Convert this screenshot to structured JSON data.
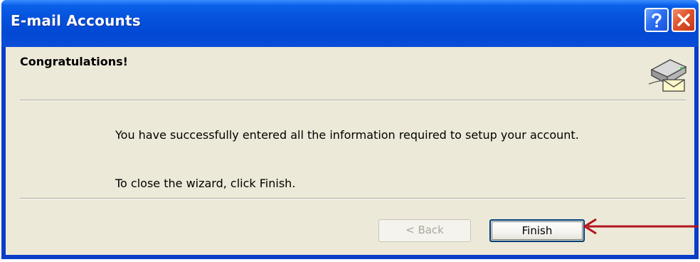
{
  "window": {
    "title": "E-mail Accounts"
  },
  "title_buttons": {
    "help_icon": "question-mark-icon",
    "close_icon": "close-icon"
  },
  "wizard": {
    "heading": "Congratulations!",
    "icon": "mail-server-envelope-icon",
    "message_1": "You have successfully entered all the information required to setup your account.",
    "message_2": "To close the wizard, click Finish."
  },
  "buttons": {
    "back_label": "< Back",
    "finish_label": "Finish"
  },
  "colors": {
    "titlebar": "#0551dc",
    "client_bg": "#ece9d8",
    "close_button": "#e0532c",
    "annotation_arrow": "#b4141e"
  }
}
